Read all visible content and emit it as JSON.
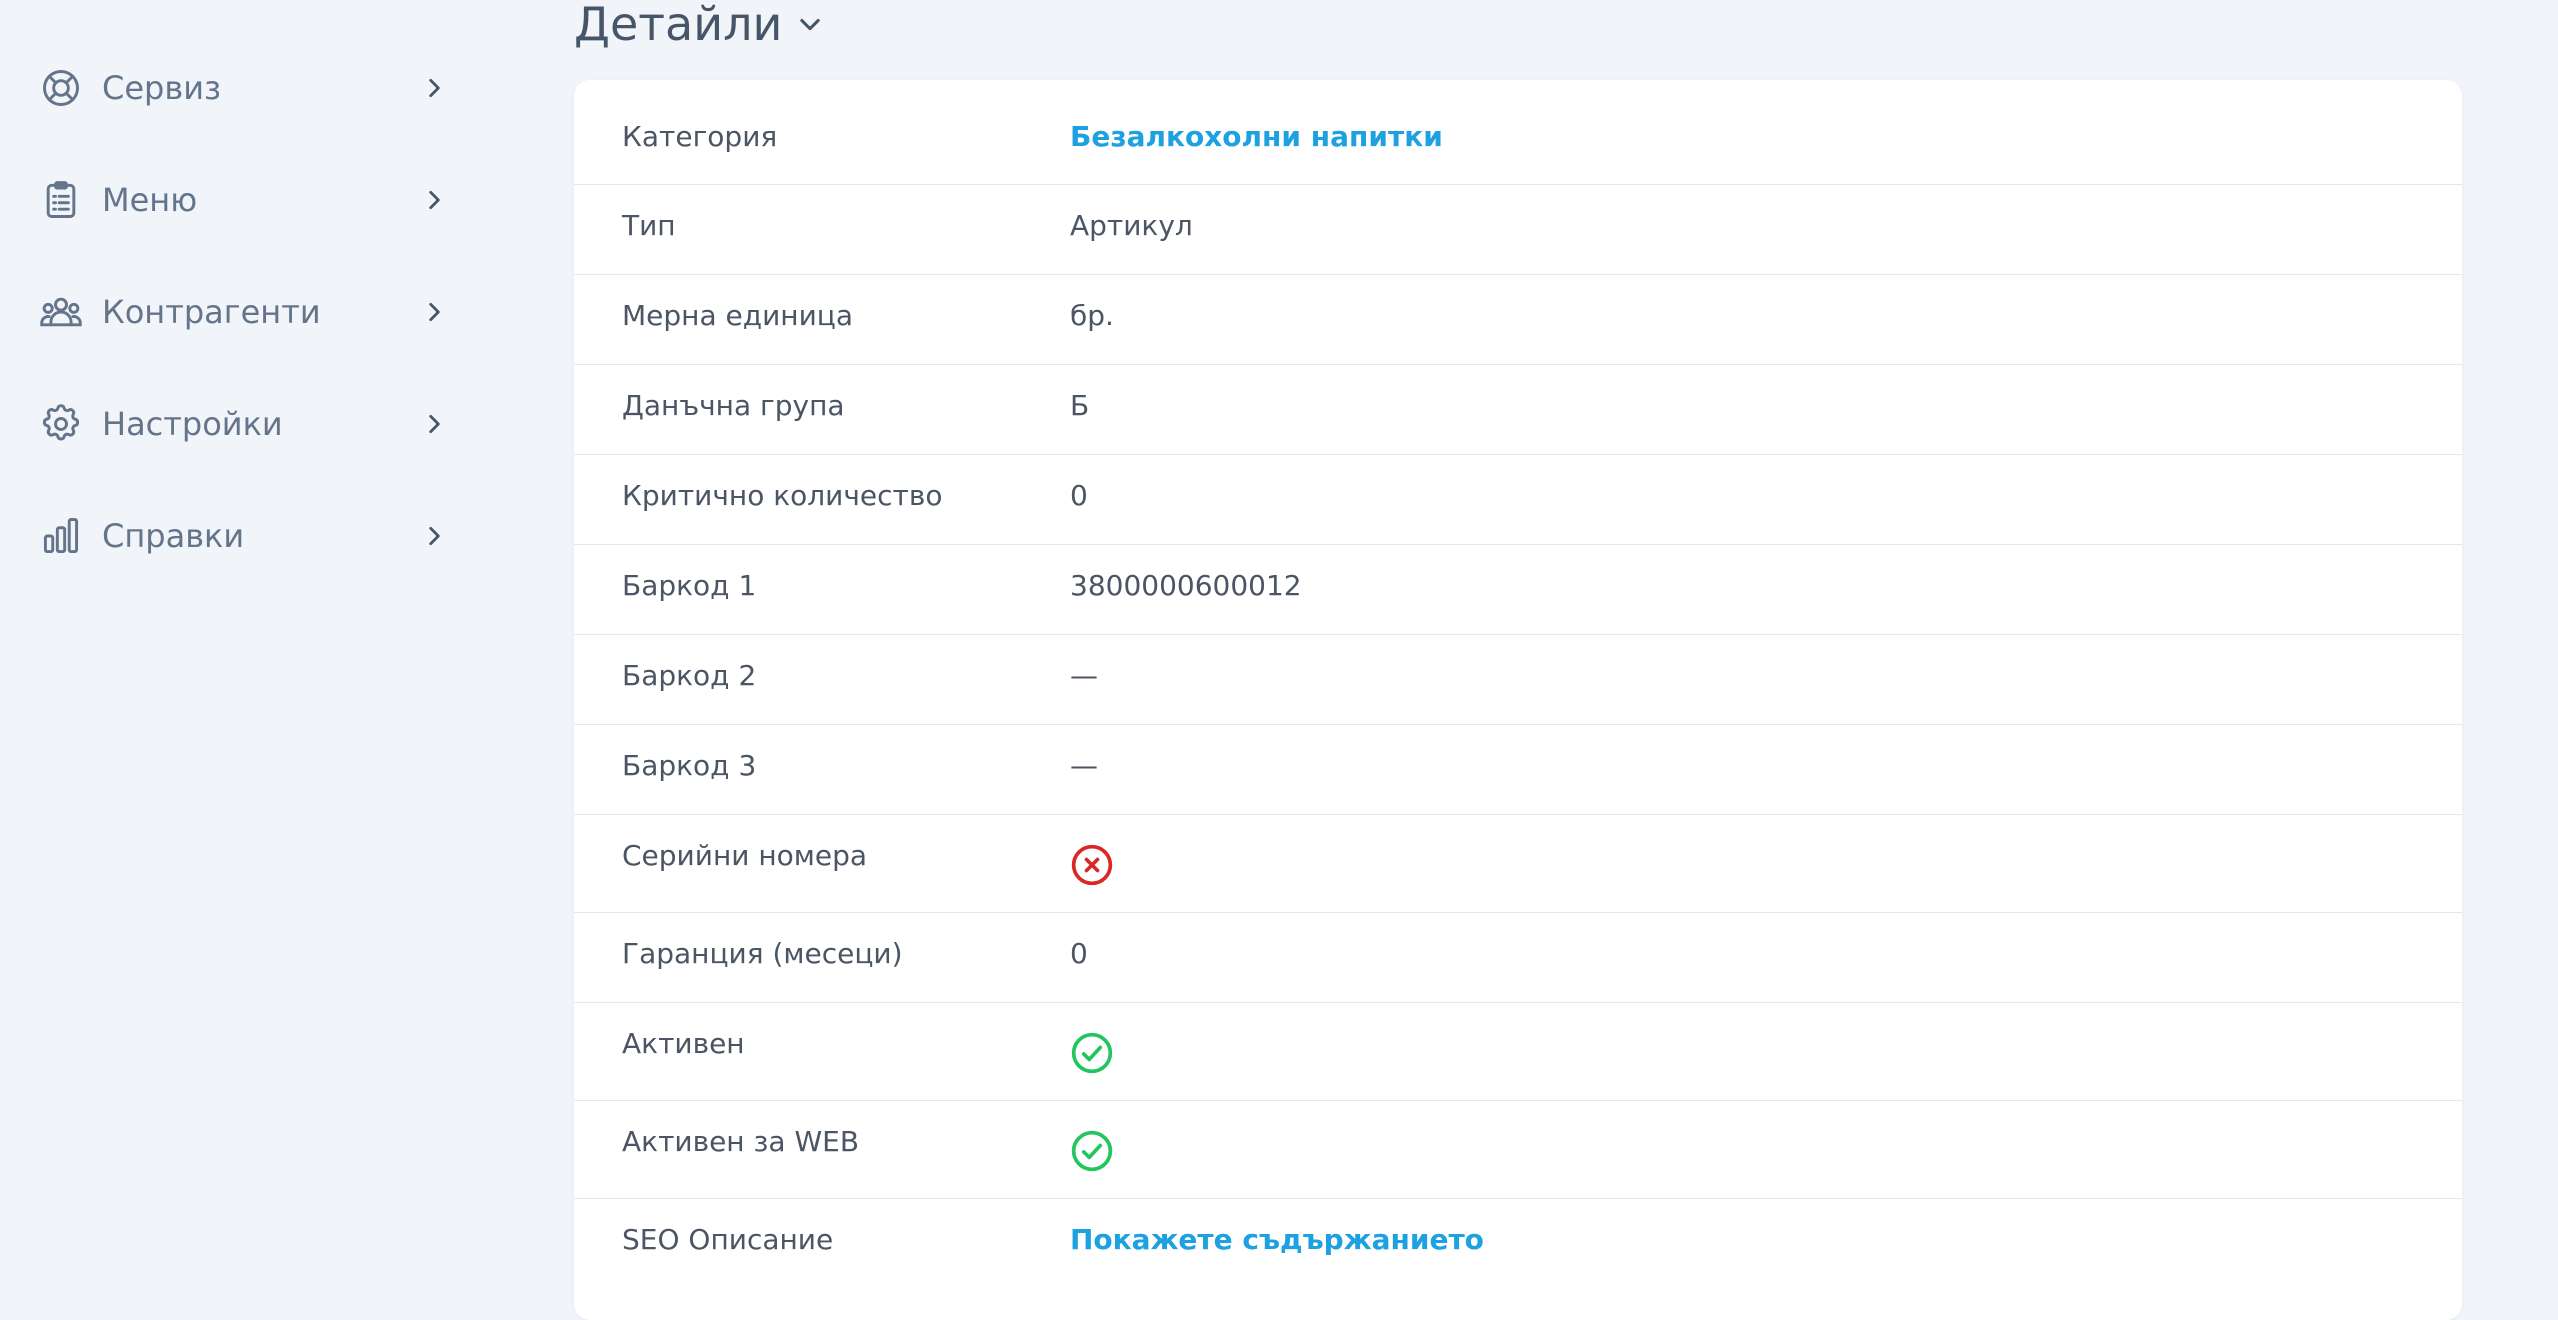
{
  "sidebar": {
    "items": [
      {
        "label": "Сервиз",
        "icon": "lifebuoy-icon"
      },
      {
        "label": "Меню",
        "icon": "clipboard-list-icon"
      },
      {
        "label": "Контрагенти",
        "icon": "users-icon"
      },
      {
        "label": "Настройки",
        "icon": "gear-icon"
      },
      {
        "label": "Справки",
        "icon": "bar-chart-icon"
      }
    ]
  },
  "section": {
    "title": "Детайли"
  },
  "details": {
    "category": {
      "label": "Категория",
      "value": "Безалкохолни напитки"
    },
    "type": {
      "label": "Тип",
      "value": "Артикул"
    },
    "unit": {
      "label": "Мерна единица",
      "value": "бр."
    },
    "tax_group": {
      "label": "Данъчна група",
      "value": "Б"
    },
    "critical_qty": {
      "label": "Критично количество",
      "value": "0"
    },
    "barcode1": {
      "label": "Баркод 1",
      "value": "3800000600012"
    },
    "barcode2": {
      "label": "Баркод 2",
      "value": "—"
    },
    "barcode3": {
      "label": "Баркод 3",
      "value": "—"
    },
    "serials": {
      "label": "Серийни номера",
      "status": "no"
    },
    "warranty": {
      "label": "Гаранция (месеци)",
      "value": "0"
    },
    "active": {
      "label": "Активен",
      "status": "yes"
    },
    "active_web": {
      "label": "Активен за WEB",
      "status": "yes"
    },
    "seo": {
      "label": "SEO Описание",
      "value": "Покажете съдържанието"
    }
  },
  "colors": {
    "link": "#1ea1e0",
    "success": "#22c55e",
    "danger": "#dc2626",
    "background": "#f1f5f9"
  }
}
